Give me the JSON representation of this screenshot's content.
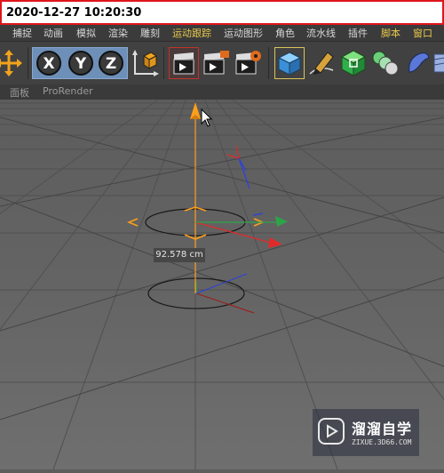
{
  "timestamp": "2020-12-27 10:20:30",
  "menu": {
    "items": [
      "捕捉",
      "动画",
      "模拟",
      "渲染",
      "雕刻",
      "运动跟踪",
      "运动图形",
      "角色",
      "流水线",
      "插件",
      "脚本",
      "窗口"
    ]
  },
  "toolbar": {
    "axis_x": "X",
    "axis_y": "Y",
    "axis_z": "Z"
  },
  "viewport_menu": {
    "panel": "面板",
    "prorender": "ProRender"
  },
  "viewport": {
    "dimension_label": "92.578 cm"
  },
  "watermark": {
    "title": "溜溜自学",
    "url": "ZIXUE.3D66.COM"
  },
  "colors": {
    "accent_menu": "#e8c84a",
    "axis_x": "#e02a2a",
    "axis_y": "#2ea44a",
    "axis_z": "#2d3fe0",
    "gizmo": "#ff9f1a"
  }
}
